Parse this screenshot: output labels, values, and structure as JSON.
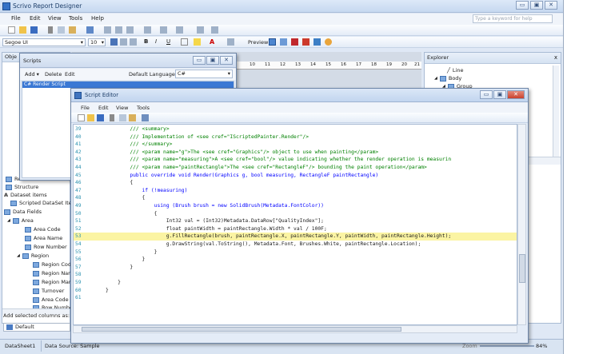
{
  "app": {
    "title": "Scrivo Report Designer",
    "help_placeholder": "Type a keyword for help"
  },
  "menu": [
    "File",
    "Edit",
    "View",
    "Tools",
    "Help"
  ],
  "toolbar": {
    "font": "Segoe UI",
    "size": "10",
    "preview": "Preview"
  },
  "object_panel": {
    "title": "Obje"
  },
  "scripts_window": {
    "title": "Scripts",
    "add": "Add",
    "delete": "Delete",
    "edit": "Edit",
    "lang_label": "Default Language:",
    "lang_value": "C#",
    "item": "C# Render Script"
  },
  "explorer": {
    "title": "Explorer",
    "items": [
      "Line",
      "Body",
      "Group"
    ]
  },
  "tree": [
    "Reaction",
    "Structure",
    "Dataset items",
    "Scripted DataSet Ite",
    "Data Fields",
    "Area",
    "Area Code",
    "Area Name",
    "Row Number",
    "Region",
    "Region Cod",
    "Region Nan",
    "Region Man",
    "Turnover",
    "Area Code",
    "Row Numbe"
  ],
  "left_bottom": {
    "label": "Add selected columns as:",
    "value": "Default"
  },
  "status": {
    "sheet": "DataSheet1",
    "source": "Data Source: Sample",
    "zoom_label": "Zoom",
    "zoom": "84%"
  },
  "ruler_numbers": [
    "10",
    "11",
    "12",
    "13",
    "14",
    "15",
    "16",
    "17",
    "18",
    "19",
    "20",
    "21"
  ],
  "editor": {
    "title": "Script Editor",
    "menu": [
      "File",
      "Edit",
      "View",
      "Tools"
    ],
    "lines": [
      {
        "n": "39",
        "t": "        /// <summary>",
        "c": "cm"
      },
      {
        "n": "40",
        "t": "        /// Implementation of <see cref=\"IScriptedPainter.Render\"/>",
        "c": "cm"
      },
      {
        "n": "41",
        "t": "        /// </summary>",
        "c": "cm"
      },
      {
        "n": "42",
        "t": "        /// <param name=\"g\">The <see cref=\"Graphics\"/> object to use when painting</param>",
        "c": "cm"
      },
      {
        "n": "43",
        "t": "        /// <param name=\"measuring\">A <see cref=\"bool\"/> value indicating whether the render operation is measurin",
        "c": "cm"
      },
      {
        "n": "44",
        "t": "        /// <param name=\"paintRectangle\">The <see cref=\"RectangleF\"/> bounding the paint operation</param>",
        "c": "cm"
      },
      {
        "n": "45",
        "t": "        public override void Render(Graphics g, bool measuring, RectangleF paintRectangle)",
        "c": "kw"
      },
      {
        "n": "46",
        "t": "        {",
        "c": ""
      },
      {
        "n": "47",
        "t": "            if (!measuring)",
        "c": "kw"
      },
      {
        "n": "48",
        "t": "            {",
        "c": ""
      },
      {
        "n": "49",
        "t": "                using (Brush brush = new SolidBrush(Metadata.FontColor))",
        "c": "kw"
      },
      {
        "n": "50",
        "t": "                {",
        "c": ""
      },
      {
        "n": "51",
        "t": "                    Int32 val = (Int32)Metadata.DataRow[\"QualityIndex\"];",
        "c": ""
      },
      {
        "n": "52",
        "t": "                    float paintWidth = paintRectangle.Width * val / 100F;",
        "c": ""
      },
      {
        "n": "53",
        "t": "                    g.FillRectangle(brush, paintRectangle.X, paintRectangle.Y, paintWidth, paintRectangle.Height);",
        "c": ""
      },
      {
        "n": "54",
        "t": "                    g.DrawString(val.ToString(), Metadata.Font, Brushes.White, paintRectangle.Location);",
        "c": ""
      },
      {
        "n": "55",
        "t": "                }",
        "c": ""
      },
      {
        "n": "56",
        "t": "            }",
        "c": ""
      },
      {
        "n": "57",
        "t": "        }",
        "c": ""
      },
      {
        "n": "58",
        "t": "",
        "c": ""
      },
      {
        "n": "59",
        "t": "    }",
        "c": ""
      },
      {
        "n": "60",
        "t": "}",
        "c": ""
      },
      {
        "n": "61",
        "t": "",
        "c": ""
      }
    ]
  }
}
